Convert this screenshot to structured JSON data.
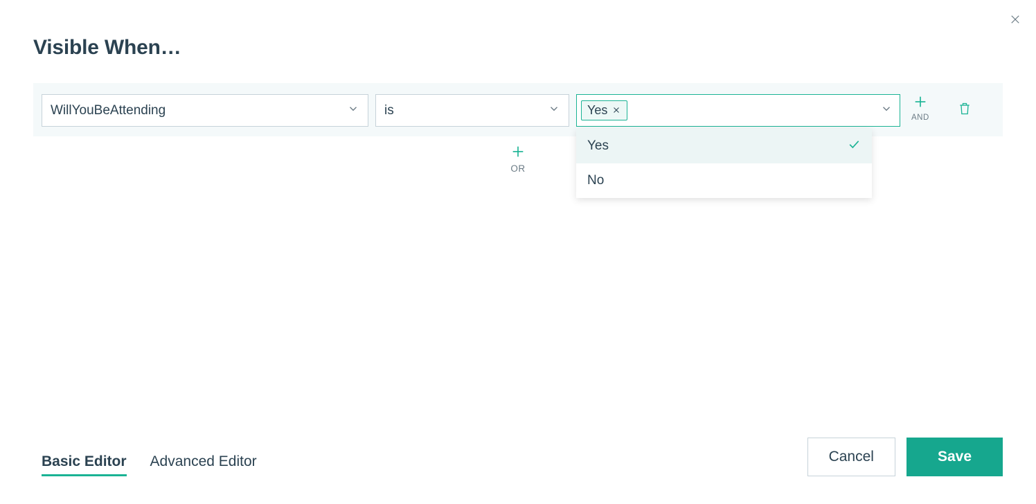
{
  "dialog": {
    "title": "Visible When…"
  },
  "rule": {
    "field": "WillYouBeAttending",
    "operator": "is",
    "value_chip": "Yes",
    "and_label": "AND",
    "or_label": "OR",
    "dropdown_options": [
      {
        "label": "Yes",
        "selected": true
      },
      {
        "label": "No",
        "selected": false
      }
    ]
  },
  "tabs": {
    "basic": "Basic Editor",
    "advanced": "Advanced Editor"
  },
  "buttons": {
    "cancel": "Cancel",
    "save": "Save"
  },
  "colors": {
    "accent": "#1ab394",
    "text": "#2b4251"
  }
}
